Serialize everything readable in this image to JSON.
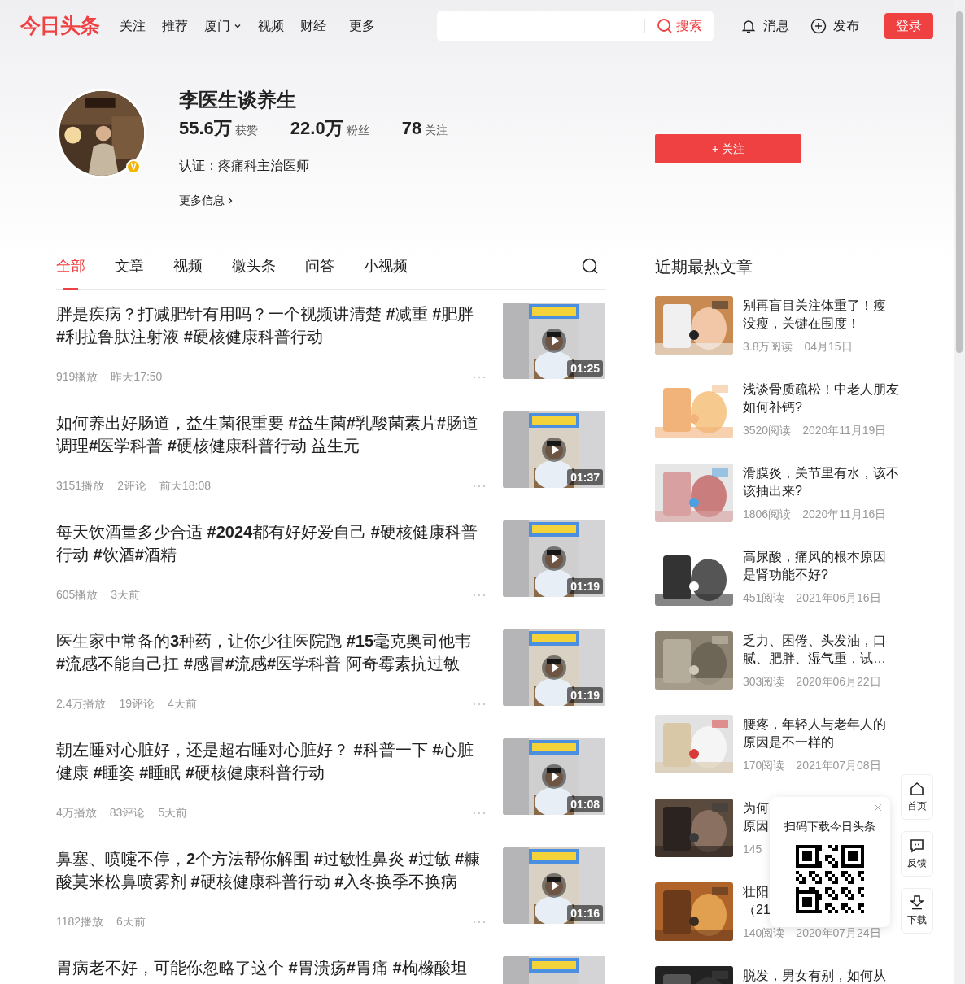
{
  "header": {
    "logo": "今日头条",
    "nav": [
      {
        "label": "关注",
        "dropdown": false
      },
      {
        "label": "推荐",
        "dropdown": false
      },
      {
        "label": "厦门",
        "dropdown": true
      },
      {
        "label": "视频",
        "dropdown": false
      },
      {
        "label": "财经",
        "dropdown": false
      },
      {
        "label": "更多",
        "dropdown": false
      }
    ],
    "search_button": "搜索",
    "messages": "消息",
    "publish": "发布",
    "login": "登录"
  },
  "profile": {
    "name": "李医生谈养生",
    "verified_badge": "V",
    "stats": [
      {
        "value": "55.6万",
        "label": "获赞"
      },
      {
        "value": "22.0万",
        "label": "粉丝"
      },
      {
        "value": "78",
        "label": "关注"
      }
    ],
    "certification": "认证：疼痛科主治医师",
    "more_info": "更多信息",
    "follow_button": "+ 关注"
  },
  "tabs": [
    {
      "label": "全部",
      "selected": true
    },
    {
      "label": "文章",
      "selected": false
    },
    {
      "label": "视频",
      "selected": false
    },
    {
      "label": "微头条",
      "selected": false
    },
    {
      "label": "问答",
      "selected": false
    },
    {
      "label": "小视频",
      "selected": false
    }
  ],
  "feed": [
    {
      "lines": [
        "胖是疾病？打减肥针有用吗？一个视频讲清楚 **#**减重 **#**肥胖",
        "**#**利拉鲁肽注射液 **#**硬核健康科普行动"
      ],
      "meta": [
        "919播放",
        "昨天17:50"
      ],
      "duration": "01:25"
    },
    {
      "lines": [
        "如何养出好肠道，益生菌很重要 **#**益生菌**#**乳酸菌素片**#**肠道",
        "调理**#**医学科普 **#**硬核健康科普行动 益生元"
      ],
      "meta": [
        "3151播放",
        "2评论",
        "前天18:08"
      ],
      "duration": "01:37"
    },
    {
      "lines": [
        "每天饮酒量多少合适 **#2024**都有好好爱自己 **#**硬核健康科普",
        "行动 **#**饮酒**#**酒精"
      ],
      "meta": [
        "605播放",
        "3天前"
      ],
      "duration": "01:19"
    },
    {
      "lines": [
        "医生家中常备的**3**种药，让你少往医院跑 **#15**毫克奥司他韦",
        "**#**流感不能自己扛 **#**感冒**#**流感**#**医学科普 阿奇霉素抗过敏"
      ],
      "meta": [
        "2.4万播放",
        "19评论",
        "4天前"
      ],
      "duration": "01:19"
    },
    {
      "lines": [
        "朝左睡对心脏好，还是超右睡对心脏好？ **#**科普一下 **#**心脏",
        "健康 **#**睡姿 **#**睡眠 **#**硬核健康科普行动"
      ],
      "meta": [
        "4万播放",
        "83评论",
        "5天前"
      ],
      "duration": "01:08"
    },
    {
      "lines": [
        "鼻塞、喷嚏不停，**2**个方法帮你解围 **#**过敏性鼻炎 **#**过敏 **#**糠",
        "酸莫米松鼻喷雾剂 **#**硬核健康科普行动 **#**入冬换季不换病"
      ],
      "meta": [
        "1182播放",
        "6天前"
      ],
      "duration": "01:16"
    },
    {
      "lines": [
        "胃病老不好，可能你忽略了这个 **#**胃溃疡**#**胃痛 **#**枸橼酸坦"
      ]
    }
  ],
  "hot": {
    "title": "近期最热文章",
    "items": [
      {
        "lines": [
          "别再盲目关注体重了！瘦",
          "没瘦，关键在围度！"
        ],
        "meta": [
          "3.8万阅读",
          "04月15日"
        ]
      },
      {
        "lines": [
          "浅谈骨质疏松！中老人朋友",
          "如何补钙?"
        ],
        "meta": [
          "3520阅读",
          "2020年11月19日"
        ]
      },
      {
        "lines": [
          "滑膜炎，关节里有水，该不",
          "该抽出来?"
        ],
        "meta": [
          "1806阅读",
          "2020年11月16日"
        ]
      },
      {
        "lines": [
          "高尿酸，痛风的根本原因",
          "是肾功能不好?"
        ],
        "meta": [
          "451阅读",
          "2021年06月16日"
        ]
      },
      {
        "lines": [
          "乏力、困倦、头发油，口",
          "腻、肥胖、湿气重，试…"
        ],
        "meta": [
          "303阅读",
          "2020年06月22日"
        ]
      },
      {
        "lines": [
          "腰疼，年轻人与老年人的",
          "原因是不一样的"
        ],
        "meta": [
          "170阅读",
          "2021年07月08日"
        ]
      },
      {
        "lines": [
          "为何",
          "原因"
        ],
        "meta": [
          "145"
        ]
      },
      {
        "lines": [
          "壮阳",
          "（21"
        ],
        "meta": [
          "140阅读",
          "2020年07月24日"
        ]
      },
      {
        "lines": [
          "脱发，男女有别，如何从"
        ]
      }
    ]
  },
  "qr_popup": {
    "title": "扫码下载今日头条"
  },
  "side_buttons": [
    {
      "kind": "home",
      "label": "首页"
    },
    {
      "kind": "feedback",
      "label": "反馈"
    },
    {
      "kind": "download",
      "label": "下载"
    }
  ]
}
